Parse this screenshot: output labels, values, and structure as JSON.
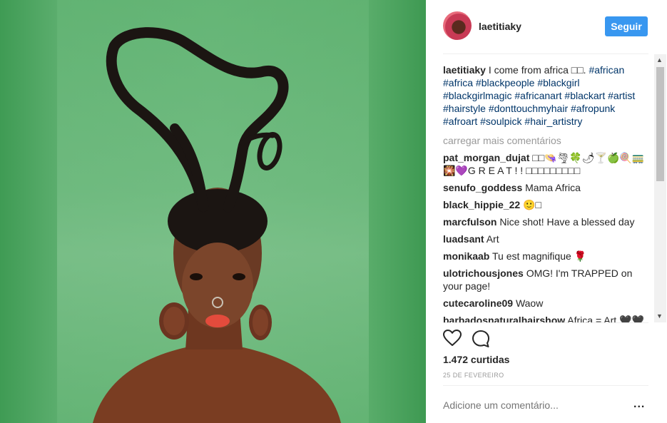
{
  "post": {
    "username": "laetitiaky",
    "follow_label": "Seguir",
    "caption_user": "laetitiaky",
    "caption_text": "I come from africa □□.",
    "hashtags": [
      "#african",
      "#africa",
      "#blackpeople",
      "#blackgirl",
      "#blackgirlmagic",
      "#africanart",
      "#blackart",
      "#artist",
      "#hairstyle",
      "#donttouchmyhair",
      "#afropunk",
      "#afroart",
      "#soulpick",
      "#hair_artistry"
    ],
    "load_more": "carregar mais comentários",
    "likes": "1.472 curtidas",
    "date": "25 DE FEVEREIRO",
    "add_comment_placeholder": "Adicione um comentário...",
    "more_options": "..."
  },
  "comments": [
    {
      "user": "pat_morgan_dujat",
      "text": "□□👒🌪🍀🌶🍸🍏🍭🚃 🎇💜G R E A T ! ! □□□□□□□□□"
    },
    {
      "user": "senufo_goddess",
      "text": "Mama Africa"
    },
    {
      "user": "black_hippie_22",
      "text": "🙂□"
    },
    {
      "user": "marcfulson",
      "text": "Nice shot! Have a blessed day"
    },
    {
      "user": "luadsant",
      "text": "Art"
    },
    {
      "user": "monikaab",
      "text": "Tu est magnifique 🌹"
    },
    {
      "user": "ulotrichousjones",
      "text": "OMG! I'm TRAPPED on your page!"
    },
    {
      "user": "cutecaroline09",
      "text": "Waow"
    },
    {
      "user": "barbadosnaturalhairshow",
      "text": "Africa = Art 🖤🖤"
    }
  ],
  "colors": {
    "accent": "#3897f0",
    "hashtag": "#003569",
    "muted": "#999999",
    "backdrop": "#5cae6e"
  },
  "icons": {
    "like": "heart-icon",
    "comment": "speech-bubble-icon",
    "more": "ellipsis-icon"
  }
}
